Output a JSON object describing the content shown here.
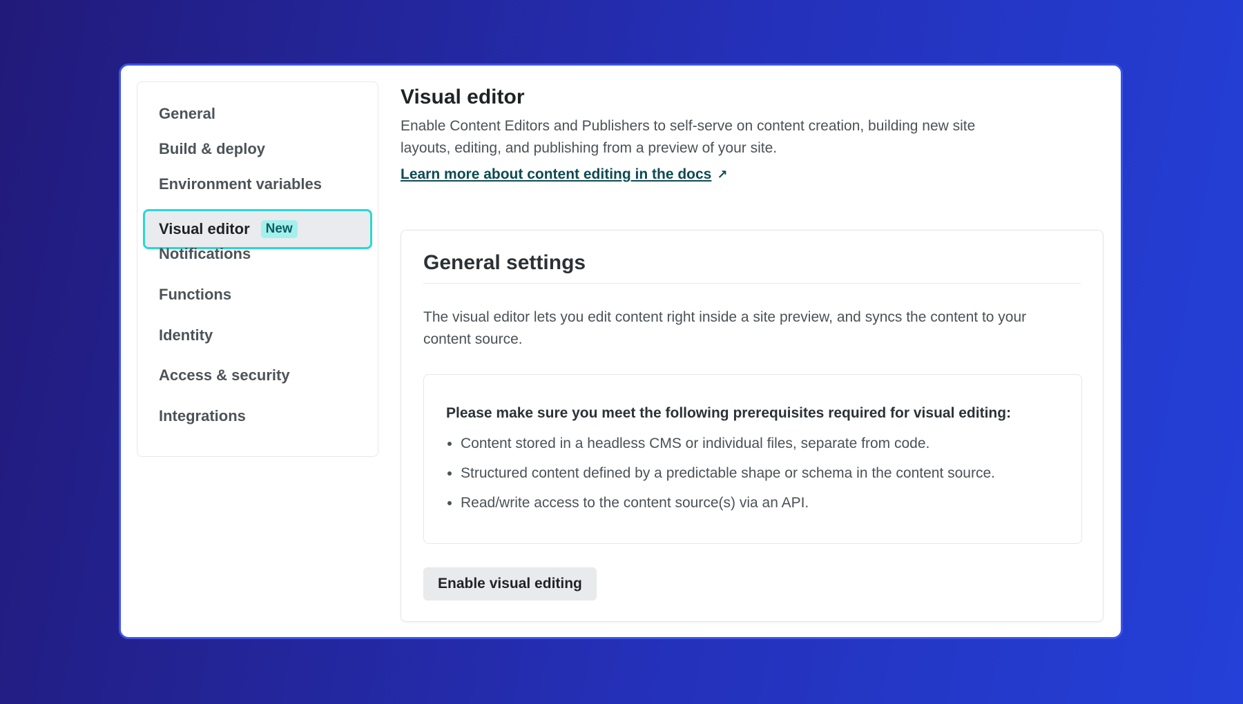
{
  "sidebar": {
    "items": [
      {
        "label": "General",
        "active": false
      },
      {
        "label": "Build & deploy",
        "active": false
      },
      {
        "label": "Environment variables",
        "active": false
      },
      {
        "label": "Visual editor",
        "active": true,
        "badge": "New"
      },
      {
        "label": "Notifications",
        "active": false
      },
      {
        "label": "Functions",
        "active": false
      },
      {
        "label": "Identity",
        "active": false
      },
      {
        "label": "Access & security",
        "active": false
      },
      {
        "label": "Integrations",
        "active": false
      }
    ]
  },
  "main": {
    "title": "Visual editor",
    "description": "Enable Content Editors and Publishers to self-serve on content creation, building new site layouts, editing, and publishing from a preview of your site.",
    "docs_link": "Learn more about content editing in the docs",
    "docs_link_icon": "external-link-icon",
    "card": {
      "title": "General settings",
      "description": "The visual editor lets you edit content right inside a site preview, and syncs the content to your content source.",
      "prereq_heading": "Please make sure you meet the following prerequisites required for visual editing:",
      "prereqs": [
        "Content stored in a headless CMS or individual files, separate from code.",
        "Structured content defined by a predictable shape or schema in the content source.",
        "Read/write access to the content source(s) via an API."
      ],
      "button_label": "Enable visual editing"
    }
  },
  "colors": {
    "frame_border": "#3a55e6",
    "active_border": "#2ad7d2",
    "badge_bg": "#a5f0ec",
    "badge_text": "#0b5f5f",
    "link": "#0d4a52"
  }
}
